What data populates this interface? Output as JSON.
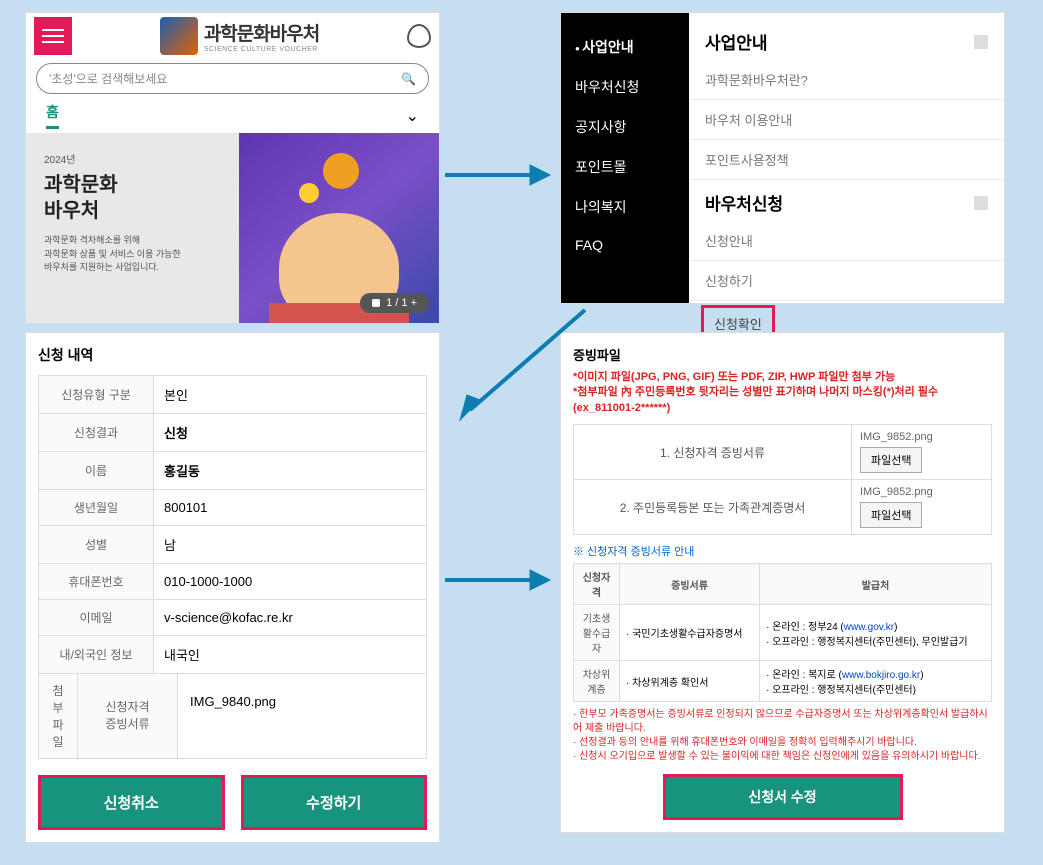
{
  "s1": {
    "logo_main": "과학문화바우처",
    "logo_sub": "SCIENCE CULTURE VOUCHER",
    "search_placeholder": "'초성'으로 검색해보세요",
    "tab_home": "홈",
    "banner_year": "2024년",
    "banner_title": "과학문화\n바우처",
    "banner_desc": "과학문화 격차해소를 위해\n과학문화 상품 및 서비스 이용 가능한\n바우처를 지원하는 사업입니다.",
    "pager": "1 / 1 +"
  },
  "s2": {
    "menu": [
      "사업안내",
      "바우처신청",
      "공지사항",
      "포인트몰",
      "나의복지",
      "FAQ"
    ],
    "group1_title": "사업안내",
    "group1_items": [
      "과학문화바우처란?",
      "바우처 이용안내",
      "포인트사용정책"
    ],
    "group2_title": "바우처신청",
    "group2_items": [
      "신청안내",
      "신청하기",
      "신청확인"
    ]
  },
  "s3": {
    "title": "신청 내역",
    "rows": [
      [
        "신청유형 구분",
        "본인"
      ],
      [
        "신청결과",
        "신청"
      ],
      [
        "이름",
        "홍길동"
      ],
      [
        "생년월일",
        "800101"
      ],
      [
        "성별",
        "남"
      ],
      [
        "휴대폰번호",
        "010-1000-1000"
      ],
      [
        "이메일",
        "v-science@kofac.re.kr"
      ],
      [
        "내/외국인 정보",
        "내국인"
      ]
    ],
    "attach_label": "첨부파일",
    "attach_sub": "신청자격\n증빙서류",
    "attach_file": "IMG_9840.png",
    "btn_cancel": "신청취소",
    "btn_edit": "수정하기"
  },
  "s4": {
    "title": "증빙파일",
    "notice": "*이미지 파일(JPG, PNG, GIF) 또는 PDF, ZIP, HWP 파일만 첨부 가능\n*첨부파일 內 주민등록번호 뒷자리는 성별만 표기하며 나머지 마스킹(*)처리 필수(ex_811001-2******)",
    "up1_label": "1. 신청자격 증빙서류",
    "up1_file": "IMG_9852.png",
    "up2_label": "2. 주민등록등본 또는 가족관계증명서",
    "up2_file": "IMG_9852.png",
    "filebtn": "파일선택",
    "guide_title": "※ 신청자격 증빙서류 안내",
    "gh": [
      "신청자격",
      "증빙서류",
      "발급처"
    ],
    "gr1_cat": "기초생활수급자",
    "gr1_doc": "· 국민기초생활수급자증명서",
    "gr1_src_a": "· 온라인 : 정부24 (",
    "gr1_src_url": "www.gov.kr",
    "gr1_src_b": ")\n· 오프라인 : 행정복지센터(주민센터), 무인발급기",
    "gr2_cat": "차상위계층",
    "gr2_doc": "· 차상위계층 확인서",
    "gr2_src_a": "· 온라인 : 복지로 (",
    "gr2_src_url": "www.bokjiro.go.kr",
    "gr2_src_b": ")\n· 오프라인 : 행정복지센터(주민센터)",
    "warn": "· 한부모 가족증명서는 증빙서류로 인정되지 않으므로 수급자증명서 또는 차상위계층확인서 발급하시어 제출 바랍니다.\n· 선정결과 등의 안내를 위해 휴대폰번호와 이메일을 정확히 입력해주시기 바랍니다.\n· 신청시 오기입으로 발생할 수 있는 불이익에 대한 책임은 신청인에게 있음을 유의하시기 바랍니다.",
    "submit": "신청서 수정"
  }
}
